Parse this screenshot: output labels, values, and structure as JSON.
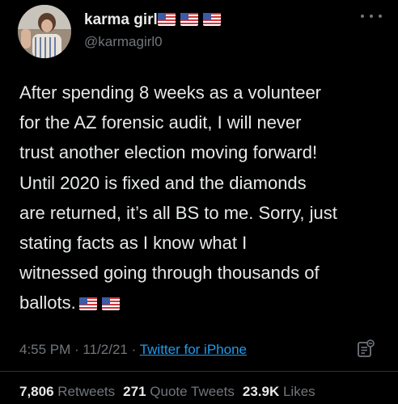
{
  "author": {
    "display_name": "karma girl",
    "handle": "@karmagirl0",
    "name_flags": [
      "us-flag-icon",
      "us-flag-icon",
      "us-flag-icon"
    ]
  },
  "more_icon": "more-options-icon",
  "body": {
    "lines": [
      "After spending 8 weeks as a volunteer",
      "for the AZ forensic audit, I will never",
      "trust another election moving forward!",
      "Until 2020 is fixed and the diamonds",
      "are returned, it’s all BS to me. Sorry, just",
      "stating facts as I know what I",
      "witnessed going through thousands of",
      "ballots."
    ],
    "trailing_flags": [
      "us-flag-icon",
      "us-flag-icon"
    ]
  },
  "meta": {
    "time": "4:55 PM",
    "sep1": " · ",
    "date": "11/2/21",
    "sep2": " · ",
    "source": "Twitter for iPhone"
  },
  "stats": {
    "retweets_count": "7,806",
    "retweets_label": "Retweets",
    "quotes_count": "271",
    "quotes_label": "Quote Tweets",
    "likes_count": "23.9K",
    "likes_label": "Likes"
  },
  "colors": {
    "background": "#000000",
    "text": "#e7e9ea",
    "secondary": "#71767b",
    "link": "#1d9bf0"
  }
}
